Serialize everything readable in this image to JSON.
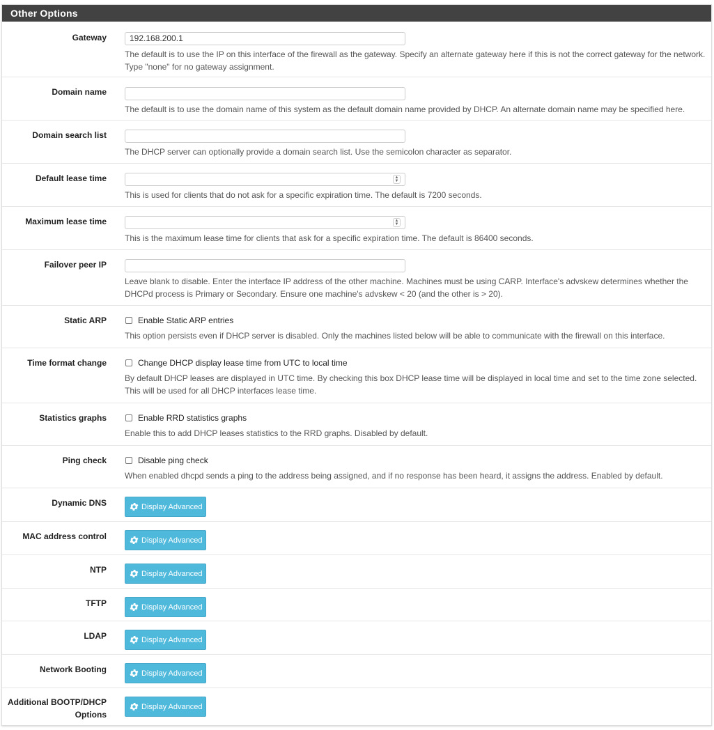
{
  "panel": {
    "title": "Other Options"
  },
  "gateway": {
    "label": "Gateway",
    "value": "192.168.200.1",
    "help": "The default is to use the IP on this interface of the firewall as the gateway. Specify an alternate gateway here if this is not the correct gateway for the network. Type \"none\" for no gateway assignment."
  },
  "domain_name": {
    "label": "Domain name",
    "value": "",
    "help": "The default is to use the domain name of this system as the default domain name provided by DHCP. An alternate domain name may be specified here."
  },
  "domain_search": {
    "label": "Domain search list",
    "value": "",
    "help": "The DHCP server can optionally provide a domain search list. Use the semicolon character as separator."
  },
  "default_lease": {
    "label": "Default lease time",
    "value": "",
    "help": "This is used for clients that do not ask for a specific expiration time. The default is 7200 seconds."
  },
  "max_lease": {
    "label": "Maximum lease time",
    "value": "",
    "help": "This is the maximum lease time for clients that ask for a specific expiration time. The default is 86400 seconds."
  },
  "failover": {
    "label": "Failover peer IP",
    "value": "",
    "help": "Leave blank to disable. Enter the interface IP address of the other machine. Machines must be using CARP. Interface's advskew determines whether the DHCPd process is Primary or Secondary. Ensure one machine's advskew < 20 (and the other is > 20)."
  },
  "static_arp": {
    "label": "Static ARP",
    "checkbox_label": "Enable Static ARP entries",
    "checked": false,
    "help": "This option persists even if DHCP server is disabled. Only the machines listed below will be able to communicate with the firewall on this interface."
  },
  "time_format": {
    "label": "Time format change",
    "checkbox_label": "Change DHCP display lease time from UTC to local time",
    "checked": false,
    "help": "By default DHCP leases are displayed in UTC time. By checking this box DHCP lease time will be displayed in local time and set to the time zone selected. This will be used for all DHCP interfaces lease time."
  },
  "stats_graphs": {
    "label": "Statistics graphs",
    "checkbox_label": "Enable RRD statistics graphs",
    "checked": false,
    "help": "Enable this to add DHCP leases statistics to the RRD graphs. Disabled by default."
  },
  "ping_check": {
    "label": "Ping check",
    "checkbox_label": "Disable ping check",
    "checked": false,
    "help": "When enabled dhcpd sends a ping to the address being assigned, and if no response has been heard, it assigns the address. Enabled by default."
  },
  "advanced": {
    "button_label": "Display Advanced",
    "rows": [
      {
        "label": "Dynamic DNS"
      },
      {
        "label": "MAC address control"
      },
      {
        "label": "NTP"
      },
      {
        "label": "TFTP"
      },
      {
        "label": "LDAP"
      },
      {
        "label": "Network Booting"
      },
      {
        "label": "Additional BOOTP/DHCP Options"
      }
    ]
  },
  "colors": {
    "header_bg": "#424242",
    "button_bg": "#4fb9dc",
    "border": "#e6e6e6"
  }
}
